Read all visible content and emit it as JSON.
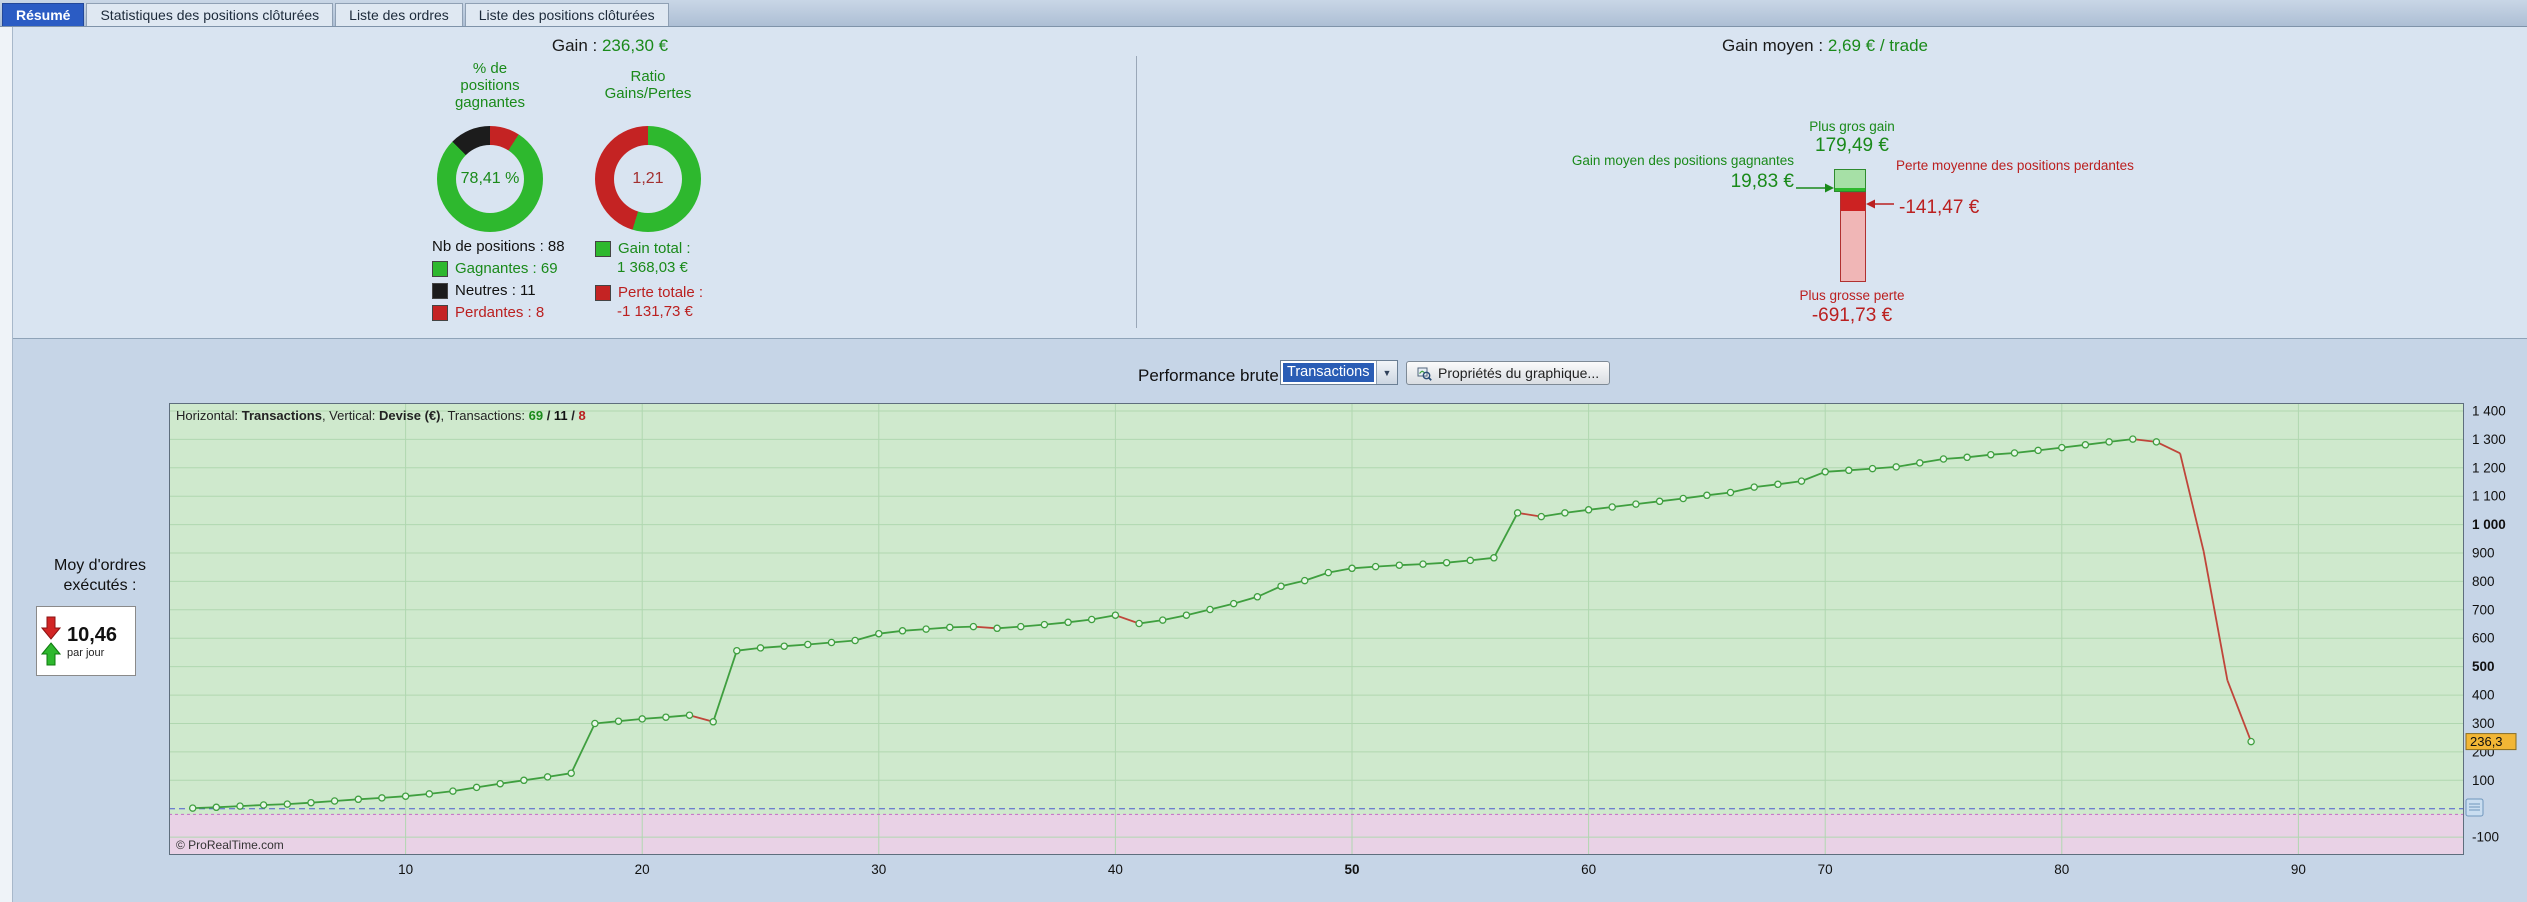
{
  "colors": {
    "accent_blue": "#2b5cc4",
    "green": "#1a8a1a",
    "red": "#bb2020"
  },
  "tabs": [
    {
      "label": "Résumé",
      "active": true
    },
    {
      "label": "Statistiques des positions clôturées",
      "active": false
    },
    {
      "label": "Liste des ordres",
      "active": false
    },
    {
      "label": "Liste des positions clôturées",
      "active": false
    }
  ],
  "summary": {
    "gain_label": "Gain :",
    "gain_value": "236,30 €",
    "win_donut": {
      "title": "% de\npositions\ngagnantes",
      "value": "78,41 %",
      "segments": [
        {
          "name": "perdantes",
          "color": "#c42323",
          "pct": 9.09
        },
        {
          "name": "gagnantes",
          "color": "#2eb82e",
          "pct": 78.41
        },
        {
          "name": "neutres",
          "color": "#1c1c1c",
          "pct": 12.5
        }
      ]
    },
    "ratio_donut": {
      "title": "Ratio\nGains/Pertes",
      "value": "1,21",
      "segments": [
        {
          "name": "gains",
          "color": "#2eb82e",
          "pct": 54.72
        },
        {
          "name": "pertes",
          "color": "#c42323",
          "pct": 45.28
        }
      ]
    },
    "positions": {
      "total_label": "Nb de positions : 88",
      "items": [
        {
          "label": "Gagnantes : 69",
          "color": "#2eb82e",
          "text_color": "#1a8a1a"
        },
        {
          "label": "Neutres : 11",
          "color": "#1c1c1c",
          "text_color": "#111111"
        },
        {
          "label": "Perdantes : 8",
          "color": "#c42323",
          "text_color": "#bb2020"
        }
      ]
    },
    "totals": {
      "gain_label": "Gain total :",
      "gain_value": "1 368,03 €",
      "gain_color": "#2eb82e",
      "loss_label": "Perte totale :",
      "loss_value": "-1 131,73 €",
      "loss_color": "#c42323"
    },
    "avg": {
      "label": "Gain moyen :",
      "value": "2,69 € / trade"
    },
    "extremes": {
      "max_gain_label": "Plus gros gain",
      "max_gain_value": "179,49 €",
      "max_gain": 179.49,
      "avg_gain_label": "Gain moyen des positions gagnantes",
      "avg_gain_value": "19,83 €",
      "avg_gain": 19.83,
      "avg_loss_label": "Perte moyenne des positions perdantes",
      "avg_loss_value": "-141,47 €",
      "avg_loss": -141.47,
      "max_loss_label": "Plus grosse perte",
      "max_loss_value": "-691,73 €",
      "max_loss": -691.73
    }
  },
  "performance": {
    "title": "Performance brute",
    "selector_value": "Transactions",
    "properties_button": "Propriétés du graphique..."
  },
  "orders_rate": {
    "label": "Moy d'ordres\nexécutés :",
    "value": "10,46",
    "unit": "par jour"
  },
  "chart_data": {
    "type": "line",
    "title": "Performance brute",
    "xlabel": "Transactions",
    "ylabel": "Devise (€)",
    "copyright": "© ProRealTime.com",
    "info_parts": [
      {
        "text": "Horizontal: "
      },
      {
        "text": "Transactions",
        "bold": true
      },
      {
        "text": ", Vertical: "
      },
      {
        "text": "Devise (€)",
        "bold": true
      },
      {
        "text": ", Transactions: "
      },
      {
        "text": "69",
        "bold": true,
        "color": "#1a8a1a"
      },
      {
        "text": " / ",
        "bold": true
      },
      {
        "text": "11",
        "bold": true,
        "color": "#111111"
      },
      {
        "text": " / ",
        "bold": true
      },
      {
        "text": "8",
        "bold": true,
        "color": "#bb2020"
      }
    ],
    "xlim": [
      0,
      97
    ],
    "ylim": [
      -163,
      1428
    ],
    "x_ticks": [
      {
        "label": "10",
        "v": 10
      },
      {
        "label": "20",
        "v": 20
      },
      {
        "label": "30",
        "v": 30
      },
      {
        "label": "40",
        "v": 40
      },
      {
        "label": "50",
        "v": 50,
        "bold": true
      },
      {
        "label": "60",
        "v": 60
      },
      {
        "label": "70",
        "v": 70
      },
      {
        "label": "80",
        "v": 80
      },
      {
        "label": "90",
        "v": 90
      }
    ],
    "y_ticks": [
      {
        "label": "1 400",
        "v": 1400
      },
      {
        "label": "1 300",
        "v": 1300
      },
      {
        "label": "1 200",
        "v": 1200
      },
      {
        "label": "1 100",
        "v": 1100
      },
      {
        "label": "1 000",
        "v": 1000,
        "bold": true
      },
      {
        "label": "900",
        "v": 900
      },
      {
        "label": "800",
        "v": 800
      },
      {
        "label": "700",
        "v": 700
      },
      {
        "label": "600",
        "v": 600
      },
      {
        "label": "500",
        "v": 500,
        "bold": true
      },
      {
        "label": "400",
        "v": 400
      },
      {
        "label": "300",
        "v": 300
      },
      {
        "label": "200",
        "v": 200
      },
      {
        "label": "100",
        "v": 100
      },
      {
        "label": "-100",
        "v": -100
      }
    ],
    "zero_line": 0,
    "negative_zone_top": -20,
    "current_value": {
      "label": "236,3",
      "v": 236.3
    },
    "points": [
      [
        1,
        2
      ],
      [
        2,
        5
      ],
      [
        3,
        9
      ],
      [
        4,
        13
      ],
      [
        5,
        16
      ],
      [
        6,
        21
      ],
      [
        7,
        27
      ],
      [
        8,
        33
      ],
      [
        9,
        38
      ],
      [
        10,
        44
      ],
      [
        11,
        52
      ],
      [
        12,
        62
      ],
      [
        13,
        75
      ],
      [
        14,
        88
      ],
      [
        15,
        100
      ],
      [
        16,
        112
      ],
      [
        17,
        125
      ],
      [
        18,
        300
      ],
      [
        19,
        308
      ],
      [
        20,
        316
      ],
      [
        21,
        322
      ],
      [
        22,
        329
      ],
      [
        23,
        306
      ],
      [
        24,
        556
      ],
      [
        25,
        566
      ],
      [
        26,
        572
      ],
      [
        27,
        578
      ],
      [
        28,
        585
      ],
      [
        29,
        592
      ],
      [
        30,
        616
      ],
      [
        31,
        626
      ],
      [
        32,
        632
      ],
      [
        33,
        638
      ],
      [
        34,
        641
      ],
      [
        35,
        635
      ],
      [
        36,
        641
      ],
      [
        37,
        648
      ],
      [
        38,
        656
      ],
      [
        39,
        666
      ],
      [
        40,
        681
      ],
      [
        41,
        652
      ],
      [
        42,
        664
      ],
      [
        43,
        681
      ],
      [
        44,
        701
      ],
      [
        45,
        722
      ],
      [
        46,
        746
      ],
      [
        47,
        783
      ],
      [
        48,
        803
      ],
      [
        49,
        831
      ],
      [
        50,
        846
      ],
      [
        51,
        852
      ],
      [
        52,
        857
      ],
      [
        53,
        861
      ],
      [
        54,
        866
      ],
      [
        55,
        874
      ],
      [
        56,
        883
      ],
      [
        57,
        1041
      ],
      [
        58,
        1028
      ],
      [
        59,
        1041
      ],
      [
        60,
        1052
      ],
      [
        61,
        1062
      ],
      [
        62,
        1072
      ],
      [
        63,
        1082
      ],
      [
        64,
        1092
      ],
      [
        65,
        1103
      ],
      [
        66,
        1113
      ],
      [
        67,
        1132
      ],
      [
        68,
        1142
      ],
      [
        69,
        1153
      ],
      [
        70,
        1186
      ],
      [
        71,
        1191
      ],
      [
        72,
        1197
      ],
      [
        73,
        1203
      ],
      [
        74,
        1217
      ],
      [
        75,
        1231
      ],
      [
        76,
        1237
      ],
      [
        77,
        1246
      ],
      [
        78,
        1252
      ],
      [
        79,
        1261
      ],
      [
        80,
        1271
      ],
      [
        81,
        1281
      ],
      [
        82,
        1291
      ],
      [
        83,
        1301
      ],
      [
        84,
        1291
      ],
      [
        85,
        1251
      ],
      [
        86,
        905
      ],
      [
        87,
        452
      ],
      [
        88,
        236.3
      ]
    ],
    "colors": {
      "up": "#3f9f3f",
      "down": "#c0453a",
      "bg": "#cfe9cd",
      "neg_bg": "#e9d2e6",
      "grid": "#b0d7b0",
      "tag_bg": "#f2b635",
      "dashed": "#4f5ad0"
    }
  }
}
